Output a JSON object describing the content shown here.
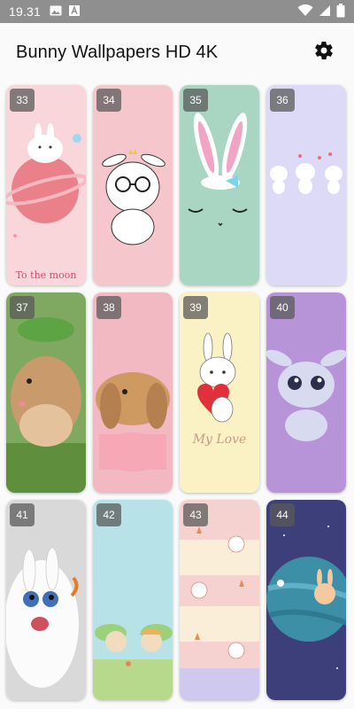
{
  "status": {
    "time": "19.31"
  },
  "app": {
    "title": "Bunny Wallpapers HD 4K"
  },
  "icons": {
    "settings": "gear-icon",
    "image": "image-icon",
    "font": "font-icon",
    "wifi": "wifi-icon",
    "signal": "signal-icon",
    "battery": "battery-icon"
  },
  "wallpapers": [
    {
      "number": "33",
      "caption": "To the moon",
      "bg": "#f8d6da"
    },
    {
      "number": "34",
      "caption": "",
      "bg": "#f5c7cd"
    },
    {
      "number": "35",
      "caption": "",
      "bg": "#a9d5c3"
    },
    {
      "number": "36",
      "caption": "",
      "bg": "#dcdaf7"
    },
    {
      "number": "37",
      "caption": "",
      "bg": "#7fa860"
    },
    {
      "number": "38",
      "caption": "",
      "bg": "#f3b9c3"
    },
    {
      "number": "39",
      "caption": "My Love",
      "bg": "#faf2c4"
    },
    {
      "number": "40",
      "caption": "",
      "bg": "#b794d8"
    },
    {
      "number": "41",
      "caption": "",
      "bg": "#d9d9d9"
    },
    {
      "number": "42",
      "caption": "",
      "bg": "#b7e3e8"
    },
    {
      "number": "43",
      "caption": "",
      "bg": "#f5d2d0"
    },
    {
      "number": "44",
      "caption": "",
      "bg": "#3d3f7a"
    }
  ]
}
